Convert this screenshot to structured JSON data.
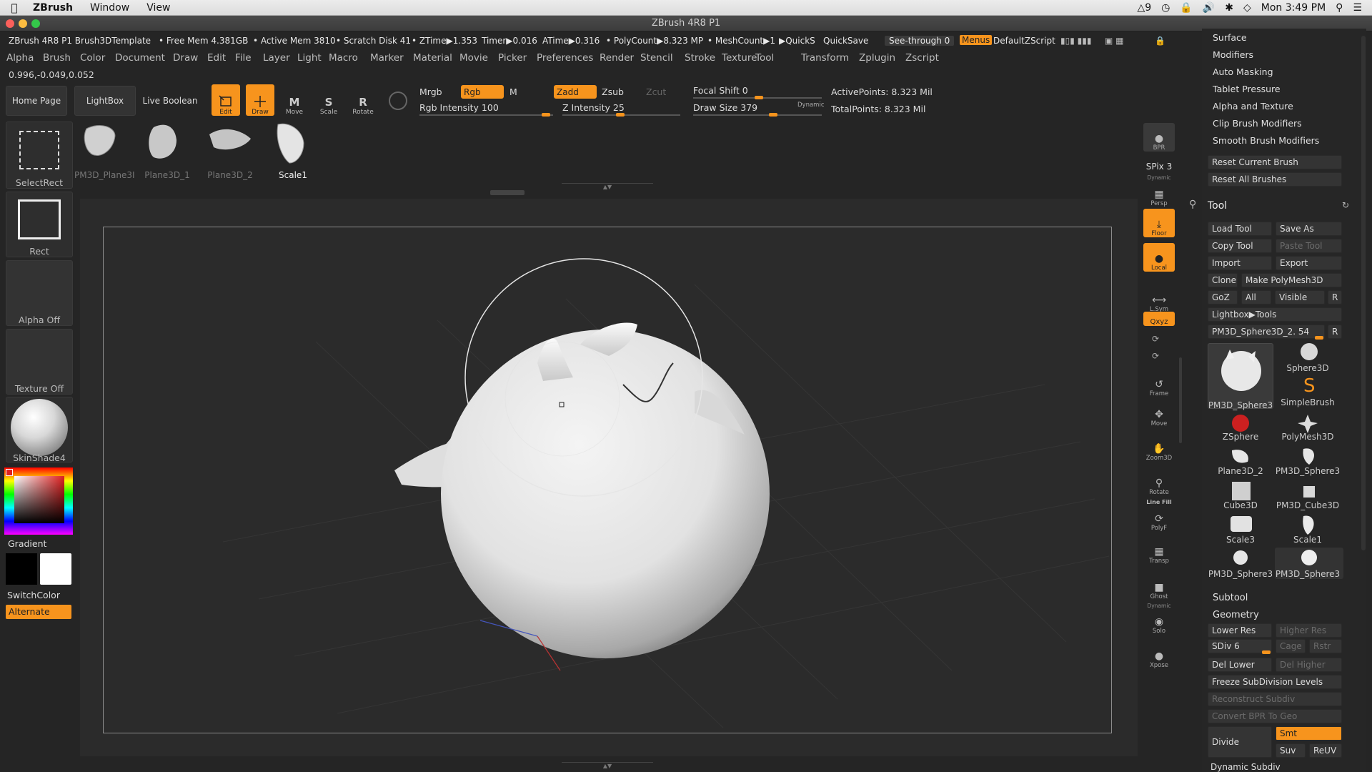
{
  "mac_menubar": {
    "app_name": "ZBrush",
    "menus": [
      "Window",
      "View"
    ],
    "status": {
      "adobe_count": "9",
      "clock": "Mon 3:49 PM"
    }
  },
  "window": {
    "title": "ZBrush 4R8 P1"
  },
  "info_bar": {
    "doc": "ZBrush 4R8 P1 Brush3DTemplate",
    "free_mem": "• Free Mem 4.381GB",
    "active_mem": "• Active Mem 3810",
    "scratch": "• Scratch Disk 41",
    "ztime": "• ZTime▶1.353",
    "timer": "Timer▶0.016",
    "atime": "ATime▶0.316",
    "polycount": "• PolyCount▶8.323 MP",
    "meshcount": "• MeshCount▶1",
    "quicks": "▶QuickS",
    "quicksave": "QuickSave",
    "see_through": "See-through  0",
    "menus": "Menus",
    "script": "DefaultZScript"
  },
  "zmenus": [
    "Alpha",
    "Brush",
    "Color",
    "Document",
    "Draw",
    "Edit",
    "File",
    "Layer",
    "Light",
    "Macro",
    "Marker",
    "Material",
    "Movie",
    "Picker",
    "Preferences",
    "Render",
    "Stencil",
    "Stroke",
    "Texture",
    "Tool",
    "Transform",
    "Zplugin",
    "Zscript"
  ],
  "coords": "0.996,-0.049,0.052",
  "top_shelf": {
    "home_page": "Home Page",
    "lightbox": "LightBox",
    "live_boolean": "Live Boolean",
    "edit": "Edit",
    "draw": "Draw",
    "move": "Move",
    "scale": "Scale",
    "rotate": "Rotate",
    "mrgb": "Mrgb",
    "rgb": "Rgb",
    "m": "M",
    "zadd": "Zadd",
    "zsub": "Zsub",
    "zcut": "Zcut",
    "rgb_intensity": "Rgb Intensity 100",
    "z_intensity": "Z Intensity 25",
    "focal_shift": "Focal Shift 0",
    "draw_size": "Draw Size 379",
    "dynamic": "Dynamic",
    "active_points": "ActivePoints: 8.323 Mil",
    "total_points": "TotalPoints: 8.323 Mil"
  },
  "tool_thumbs": [
    {
      "label": "PM3D_Plane3I",
      "active": false
    },
    {
      "label": "Plane3D_1",
      "active": false
    },
    {
      "label": "Plane3D_2",
      "active": false
    },
    {
      "label": "Scale1",
      "active": true
    }
  ],
  "left_shelf": {
    "select_rect": "SelectRect",
    "rect": "Rect",
    "alpha_off": "Alpha Off",
    "texture_off": "Texture Off",
    "material": "SkinShade4",
    "gradient": "Gradient",
    "switch_color": "SwitchColor",
    "alternate": "Alternate"
  },
  "right_shelf": [
    {
      "label": "BPR",
      "active": false
    },
    {
      "label": "SPix 3",
      "active": false
    },
    {
      "label": "Persp",
      "active": false
    },
    {
      "label": "Floor",
      "active": true
    },
    {
      "label": "Local",
      "active": true
    },
    {
      "label": "L.Sym",
      "active": false
    },
    {
      "label": "Qxyz",
      "active": true
    },
    {
      "label": "Frame",
      "active": false
    },
    {
      "label": "Move",
      "active": false
    },
    {
      "label": "Zoom3D",
      "active": false
    },
    {
      "label": "Rotate",
      "active": false
    },
    {
      "label": "PolyF",
      "active": false
    },
    {
      "label": "Transp",
      "active": false
    },
    {
      "label": "Ghost",
      "active": false
    },
    {
      "label": "Solo",
      "active": false
    },
    {
      "label": "Xpose",
      "active": false
    }
  ],
  "right_shelf_extra": {
    "dynamic": "Dynamic",
    "line_fill": "Line Fill"
  },
  "right_panel": {
    "brush_items": [
      "Surface",
      "Modifiers",
      "Auto Masking",
      "Tablet Pressure",
      "Alpha and Texture",
      "Clip Brush Modifiers",
      "Smooth Brush Modifiers"
    ],
    "reset_current_brush": "Reset Current Brush",
    "reset_all_brushes": "Reset All Brushes",
    "tool_title": "Tool",
    "load_tool": "Load Tool",
    "save_as": "Save As",
    "copy_tool": "Copy Tool",
    "paste_tool": "Paste Tool",
    "import": "Import",
    "export": "Export",
    "clone": "Clone",
    "make_polymesh": "Make PolyMesh3D",
    "goz": "GoZ",
    "all": "All",
    "visible": "Visible",
    "r": "R",
    "lightbox_tools": "Lightbox▶Tools",
    "current_tool": "PM3D_Sphere3D_2. 54",
    "tools": [
      {
        "label": "PM3D_Sphere3"
      },
      {
        "label": "Sphere3D"
      },
      {
        "label": "SimpleBrush"
      },
      {
        "label": "ZSphere"
      },
      {
        "label": "PolyMesh3D"
      },
      {
        "label": "Plane3D_2"
      },
      {
        "label": "PM3D_Sphere3"
      },
      {
        "label": "Cube3D"
      },
      {
        "label": "PM3D_Cube3D"
      },
      {
        "label": "Scale3"
      },
      {
        "label": "Scale1"
      },
      {
        "label": "PM3D_Sphere3"
      },
      {
        "label": "PM3D_Sphere3"
      }
    ],
    "subtool": "Subtool",
    "geometry": "Geometry",
    "lower_res": "Lower Res",
    "higher_res": "Higher Res",
    "sdiv": "SDiv 6",
    "cage": "Cage",
    "rstr": "Rstr",
    "del_lower": "Del Lower",
    "del_higher": "Del Higher",
    "freeze": "Freeze SubDivision Levels",
    "reconstruct": "Reconstruct Subdiv",
    "convert_bpr": "Convert BPR To Geo",
    "divide": "Divide",
    "smt": "Smt",
    "suv": "Suv",
    "reuv": "ReUV",
    "dynamic_subdiv": "Dynamic Subdiv"
  },
  "colors": {
    "accent": "#f7941d",
    "panel": "#262626",
    "canvas": "#2b2b2b"
  }
}
